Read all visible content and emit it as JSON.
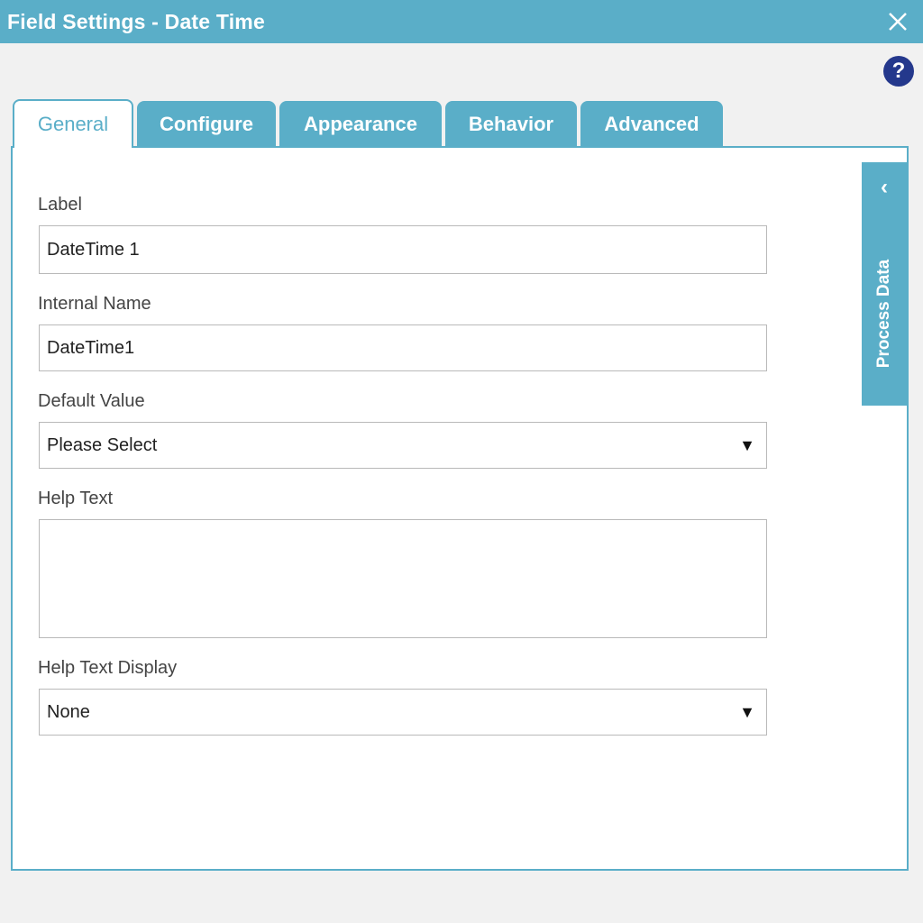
{
  "window": {
    "title": "Field Settings - Date Time",
    "close_icon": "close-icon",
    "help_label": "?"
  },
  "tabs": [
    {
      "label": "General",
      "active": true
    },
    {
      "label": "Configure",
      "active": false
    },
    {
      "label": "Appearance",
      "active": false
    },
    {
      "label": "Behavior",
      "active": false
    },
    {
      "label": "Advanced",
      "active": false
    }
  ],
  "form": {
    "label": {
      "label": "Label",
      "value": "DateTime 1"
    },
    "internal_name": {
      "label": "Internal Name",
      "value": "DateTime1"
    },
    "default_value": {
      "label": "Default Value",
      "value": "Please Select",
      "arrow": "▼"
    },
    "help_text": {
      "label": "Help Text",
      "value": ""
    },
    "help_text_display": {
      "label": "Help Text Display",
      "value": "None",
      "arrow": "▼"
    }
  },
  "side_panel": {
    "label": "Process Data",
    "chevron": "‹"
  },
  "colors": {
    "accent": "#5aaec8",
    "help_button": "#24388c",
    "background": "#f1f1f1"
  }
}
